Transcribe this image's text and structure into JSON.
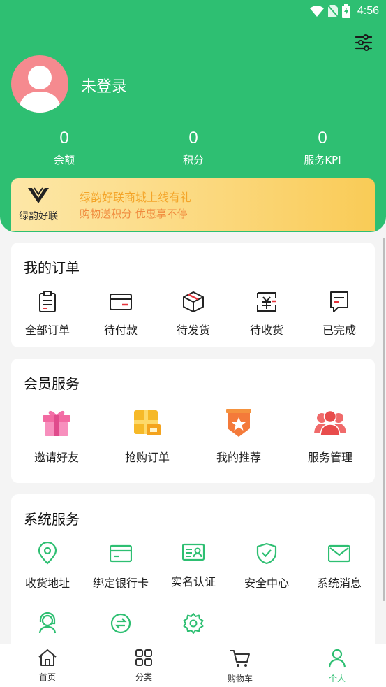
{
  "status_bar": {
    "time": "4:56"
  },
  "profile": {
    "login_text": "未登录"
  },
  "stats": [
    {
      "value": "0",
      "label": "余额"
    },
    {
      "value": "0",
      "label": "积分"
    },
    {
      "value": "0",
      "label": "服务KPI"
    }
  ],
  "promo": {
    "brand": "绿韵好联",
    "title": "绿韵好联商城上线有礼",
    "subtitle": "购物送积分 优惠享不停"
  },
  "orders": {
    "title": "我的订单",
    "items": [
      {
        "label": "全部订单",
        "icon": "clipboard-icon"
      },
      {
        "label": "待付款",
        "icon": "card-icon"
      },
      {
        "label": "待发货",
        "icon": "box-icon"
      },
      {
        "label": "待收货",
        "icon": "yuan-receipt-icon"
      },
      {
        "label": "已完成",
        "icon": "message-done-icon"
      }
    ]
  },
  "member": {
    "title": "会员服务",
    "items": [
      {
        "label": "邀请好友",
        "icon": "gift-icon"
      },
      {
        "label": "抢购订单",
        "icon": "package-icon"
      },
      {
        "label": "我的推荐",
        "icon": "star-badge-icon"
      },
      {
        "label": "服务管理",
        "icon": "team-icon"
      }
    ]
  },
  "system": {
    "title": "系统服务",
    "items": [
      {
        "label": "收货地址",
        "icon": "location-icon"
      },
      {
        "label": "绑定银行卡",
        "icon": "bank-card-icon"
      },
      {
        "label": "实名认证",
        "icon": "id-card-icon"
      },
      {
        "label": "安全中心",
        "icon": "shield-check-icon"
      },
      {
        "label": "系统消息",
        "icon": "mail-icon"
      },
      {
        "label": "",
        "icon": "customer-service-icon"
      },
      {
        "label": "",
        "icon": "exchange-icon"
      },
      {
        "label": "",
        "icon": "settings-gear-icon"
      }
    ]
  },
  "tabbar": [
    {
      "label": "首页",
      "icon": "home-icon"
    },
    {
      "label": "分类",
      "icon": "category-icon"
    },
    {
      "label": "购物车",
      "icon": "cart-icon"
    },
    {
      "label": "个人",
      "icon": "person-icon",
      "active": true
    }
  ],
  "colors": {
    "primary": "#2ebf72",
    "promo_title": "#f4a428",
    "promo_sub": "#f08a3c",
    "accent_red": "#e5343c"
  }
}
